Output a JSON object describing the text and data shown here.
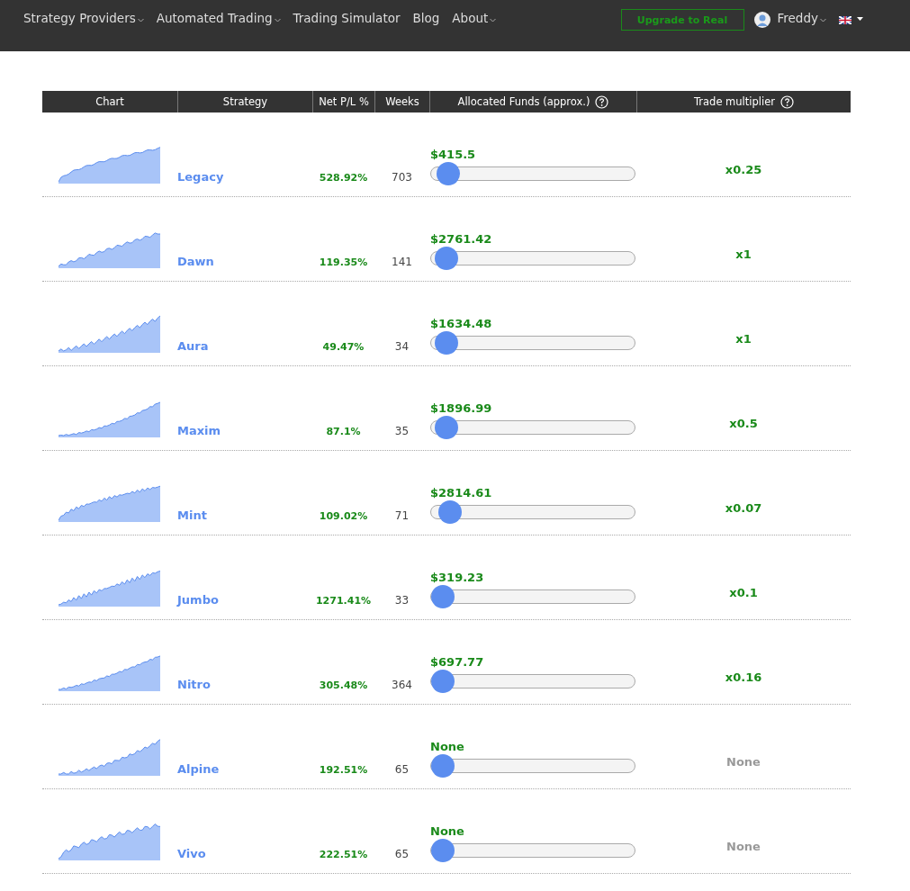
{
  "nav": {
    "items": [
      {
        "label": "Strategy Providers",
        "dropdown": true
      },
      {
        "label": "Automated Trading",
        "dropdown": true
      },
      {
        "label": "Trading Simulator",
        "dropdown": false
      },
      {
        "label": "Blog",
        "dropdown": false
      },
      {
        "label": "About",
        "dropdown": true
      }
    ],
    "upgrade_button": "Upgrade to Real",
    "user": "Freddy"
  },
  "table": {
    "columns": [
      {
        "label": "Chart",
        "help": false
      },
      {
        "label": "Strategy",
        "help": false
      },
      {
        "label": "Net P/L %",
        "help": false
      },
      {
        "label": "Weeks",
        "help": false
      },
      {
        "label": "Allocated Funds (approx.)",
        "help": true
      },
      {
        "label": "Trade multiplier",
        "help": true
      }
    ],
    "rows": [
      {
        "strategy": "Legacy",
        "net_pl": "528.92%",
        "weeks": "703",
        "allocated": "$415.5",
        "level": 0.03,
        "multiplier": "x0.25",
        "multiplier_active": true
      },
      {
        "strategy": "Dawn",
        "net_pl": "119.35%",
        "weeks": "141",
        "allocated": "$2761.42",
        "level": 0.02,
        "multiplier": "x1",
        "multiplier_active": true
      },
      {
        "strategy": "Aura",
        "net_pl": "49.47%",
        "weeks": "34",
        "allocated": "$1634.48",
        "level": 0.02,
        "multiplier": "x1",
        "multiplier_active": true
      },
      {
        "strategy": "Maxim",
        "net_pl": "87.1%",
        "weeks": "35",
        "allocated": "$1896.99",
        "level": 0.02,
        "multiplier": "x0.5",
        "multiplier_active": true
      },
      {
        "strategy": "Mint",
        "net_pl": "109.02%",
        "weeks": "71",
        "allocated": "$2814.61",
        "level": 0.04,
        "multiplier": "x0.07",
        "multiplier_active": true
      },
      {
        "strategy": "Jumbo",
        "net_pl": "1271.41%",
        "weeks": "33",
        "allocated": "$319.23",
        "level": 0.0,
        "multiplier": "x0.1",
        "multiplier_active": true
      },
      {
        "strategy": "Nitro",
        "net_pl": "305.48%",
        "weeks": "364",
        "allocated": "$697.77",
        "level": 0.0,
        "multiplier": "x0.16",
        "multiplier_active": true
      },
      {
        "strategy": "Alpine",
        "net_pl": "192.51%",
        "weeks": "65",
        "allocated": "None",
        "level": 0.0,
        "multiplier": "None",
        "multiplier_active": false
      },
      {
        "strategy": "Vivo",
        "net_pl": "222.51%",
        "weeks": "65",
        "allocated": "None",
        "level": 0.0,
        "multiplier": "None",
        "multiplier_active": false
      }
    ]
  }
}
